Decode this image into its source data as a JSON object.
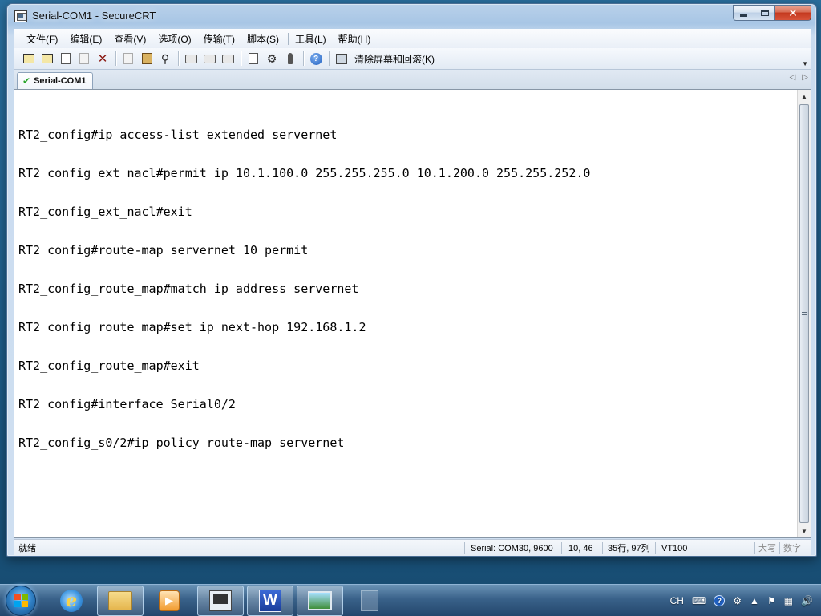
{
  "window": {
    "title": "Serial-COM1 - SecureCRT",
    "close_glyph": "✕"
  },
  "menu": {
    "items": [
      "文件(F)",
      "编辑(E)",
      "查看(V)",
      "选项(O)",
      "传输(T)",
      "脚本(S)",
      "工具(L)",
      "帮助(H)"
    ]
  },
  "toolbar": {
    "clear_label": "清除屏幕和回滚(K)",
    "icons": [
      "connect-icon",
      "quick-connect-icon",
      "connect-in-tab-icon",
      "reconnect-icon",
      "disconnect-icon",
      "copy-icon",
      "paste-icon",
      "find-icon",
      "print-screen-icon",
      "print-selection-icon",
      "print-icon",
      "session-options-icon",
      "global-options-icon",
      "keymap-icon",
      "help-icon",
      "clear-screen-icon"
    ]
  },
  "tabs": {
    "active": "Serial-COM1"
  },
  "terminal": {
    "lines": [
      "RT2_config#ip access-list extended servernet",
      "RT2_config_ext_nacl#permit ip 10.1.100.0 255.255.255.0 10.1.200.0 255.255.252.0",
      "RT2_config_ext_nacl#exit",
      "RT2_config#route-map servernet 10 permit",
      "RT2_config_route_map#match ip address servernet",
      "RT2_config_route_map#set ip next-hop 192.168.1.2",
      "RT2_config_route_map#exit",
      "RT2_config#interface Serial0/2",
      "RT2_config_s0/2#ip policy route-map servernet"
    ]
  },
  "status": {
    "ready": "就绪",
    "serial": "Serial: COM30, 9600",
    "cursor": "10,  46",
    "size": "35行, 97列",
    "emulation": "VT100",
    "caps": "大写",
    "num": "数字"
  },
  "taskbar": {
    "apps": [
      "internet-explorer",
      "file-explorer",
      "media-player",
      "securecrt",
      "word",
      "image-viewer",
      "unknown-app"
    ],
    "tray": {
      "lang": "CH"
    }
  },
  "colors": {
    "titlebar": "#b9d1ea",
    "terminal_bg": "#ffffff",
    "terminal_fg": "#000000",
    "close_button": "#c4391e",
    "taskbar": "#3a628a"
  }
}
